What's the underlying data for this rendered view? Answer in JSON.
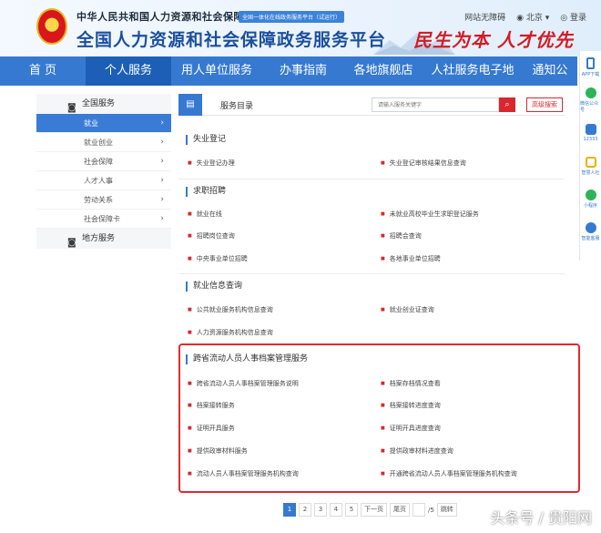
{
  "header": {
    "ministry": "中华人民共和国人力资源和社会保障部",
    "platform_title": "全国人力资源和社会保障政务服务平台",
    "tagline": "全国一体化在线政务服务平台（试运行）",
    "accessibility_link": "网站无障碍",
    "location": "北京",
    "login": "登录",
    "slogan": "民生为本 人才优先"
  },
  "nav": {
    "items": [
      "首 页",
      "个人服务",
      "用人单位服务",
      "办事指南",
      "各地旗舰店",
      "人社服务电子地",
      "通知公"
    ]
  },
  "float_bar": {
    "items": [
      "APP下载",
      "微信公众号",
      "12333",
      "智慧人社",
      "小程序",
      "智能客服"
    ]
  },
  "sidebar": {
    "national": "全国服务",
    "items": [
      "就业",
      "就业创业",
      "社会保障",
      "人才人事",
      "劳动关系",
      "社会保障卡"
    ],
    "local": "地方服务"
  },
  "panel": {
    "title": "服务目录",
    "search_placeholder": "请输入服务关键字",
    "adv_search": "高级搜索"
  },
  "sections": {
    "unemployment": {
      "title": "失业登记",
      "items": [
        "失业登记办理",
        "失业登记审核结果信息查询"
      ]
    },
    "job_search": {
      "title": "求职招聘",
      "items": [
        "就业在线",
        "未就业高校毕业生求职登记服务",
        "招聘岗位查询",
        "招聘会查询",
        "中央事业单位招聘",
        "各地事业单位招聘"
      ]
    },
    "employment_info": {
      "title": "就业信息查询",
      "items": [
        "公共就业服务机构信息查询",
        "就业创业证查询",
        "人力资源服务机构信息查询"
      ]
    },
    "archives": {
      "title": "跨省流动人员人事档案管理服务",
      "items": [
        "跨省流动人员人事档案管理服务说明",
        "档案存档情况查看",
        "档案接转服务",
        "档案接转进度查询",
        "证明开具服务",
        "证明开具进度查询",
        "提供政审材料服务",
        "提供政审材料进度查询",
        "流动人员人事档案管理服务机构查询",
        "开通跨省流动人员人事档案管理服务机构查询"
      ]
    }
  },
  "pager": {
    "pages": [
      "1",
      "2",
      "3",
      "4",
      "5"
    ],
    "next": "下一页",
    "last": "尾页",
    "page_info": "/5",
    "go": "跳转"
  },
  "watermark": "头条号 / 贵阳网",
  "colors": {
    "nav_blue": "#3679d0",
    "accent_red": "#d6282e"
  }
}
